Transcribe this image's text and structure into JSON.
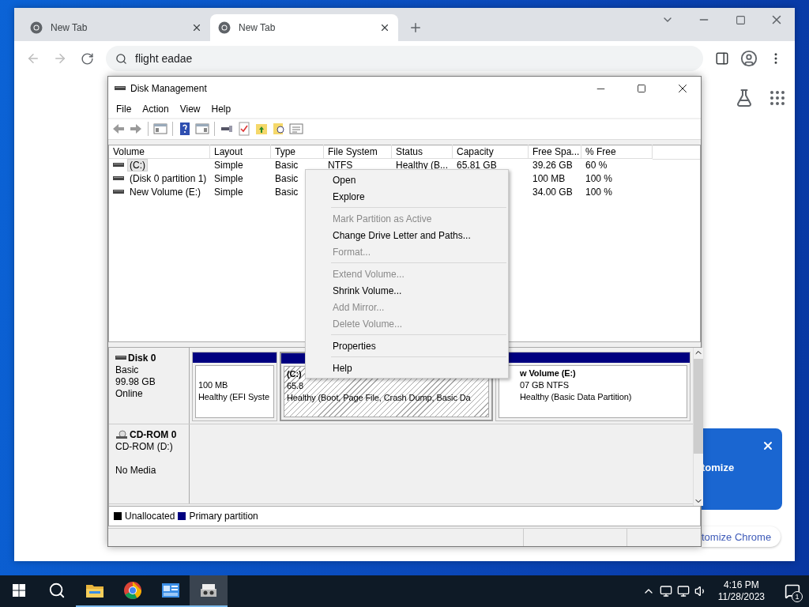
{
  "browser": {
    "tabs": [
      {
        "title": "New Tab",
        "selected": false
      },
      {
        "title": "New Tab",
        "selected": true
      }
    ],
    "address": {
      "value": "flight eadae"
    },
    "promo": {
      "title": "tomize",
      "link": "tomize Chrome"
    }
  },
  "disk_management": {
    "title": "Disk Management",
    "menu": [
      "File",
      "Action",
      "View",
      "Help"
    ],
    "columns": [
      "Volume",
      "Layout",
      "Type",
      "File System",
      "Status",
      "Capacity",
      "Free Spa...",
      "% Free"
    ],
    "volumes": [
      {
        "volume": "(C:)",
        "layout": "Simple",
        "type": "Basic",
        "file_system": "NTFS",
        "status": "Healthy (B...",
        "capacity": "65.81 GB",
        "free_space": "39.26 GB",
        "percent_free": "60 %",
        "selected": true
      },
      {
        "volume": "(Disk 0 partition 1)",
        "layout": "Simple",
        "type": "Basic",
        "free_space": "100 MB",
        "percent_free": "100 %",
        "selected": false
      },
      {
        "volume": "New Volume (E:)",
        "layout": "Simple",
        "type": "Basic",
        "free_space": "34.00 GB",
        "percent_free": "100 %",
        "selected": false
      }
    ],
    "disks": [
      {
        "kind": "disk",
        "name": "Disk 0",
        "lines": [
          "Basic",
          "99.98 GB",
          "Online"
        ],
        "partitions": [
          {
            "lines": [
              "100 MB",
              "Healthy (EFI Syste"
            ],
            "selected": false
          },
          {
            "name": "(C:)",
            "lines": [
              "65.8",
              "Healthy (Boot, Page File, Crash Dump, Basic Da"
            ],
            "selected": true
          },
          {
            "name": "w Volume  (E:)",
            "lines": [
              "07 GB NTFS",
              "Healthy (Basic Data Partition)"
            ],
            "selected": false
          }
        ]
      },
      {
        "kind": "cdrom",
        "name": "CD-ROM 0",
        "lines": [
          "CD-ROM (D:)"
        ],
        "status": "No Media"
      }
    ],
    "legend": [
      {
        "label": "Unallocated",
        "color": "#000000"
      },
      {
        "label": "Primary partition",
        "color": "#000080"
      }
    ]
  },
  "context_menu": {
    "groups": [
      [
        {
          "label": "Open",
          "disabled": false
        },
        {
          "label": "Explore",
          "disabled": false
        }
      ],
      [
        {
          "label": "Mark Partition as Active",
          "disabled": true
        },
        {
          "label": "Change Drive Letter and Paths...",
          "disabled": false
        },
        {
          "label": "Format...",
          "disabled": true
        }
      ],
      [
        {
          "label": "Extend Volume...",
          "disabled": true
        },
        {
          "label": "Shrink Volume...",
          "disabled": false
        },
        {
          "label": "Add Mirror...",
          "disabled": true
        },
        {
          "label": "Delete Volume...",
          "disabled": true
        }
      ],
      [
        {
          "label": "Properties",
          "disabled": false
        }
      ],
      [
        {
          "label": "Help",
          "disabled": false
        }
      ]
    ]
  },
  "taskbar": {
    "apps": [
      {
        "kind": "explorer",
        "running": true,
        "selected": false
      },
      {
        "kind": "browser",
        "running": true,
        "selected": false
      },
      {
        "kind": "app",
        "running": true,
        "selected": false
      },
      {
        "kind": "disk",
        "running": true,
        "selected": true
      }
    ],
    "time": "4:16 PM",
    "date": "11/28/2023",
    "notifications": "1"
  }
}
